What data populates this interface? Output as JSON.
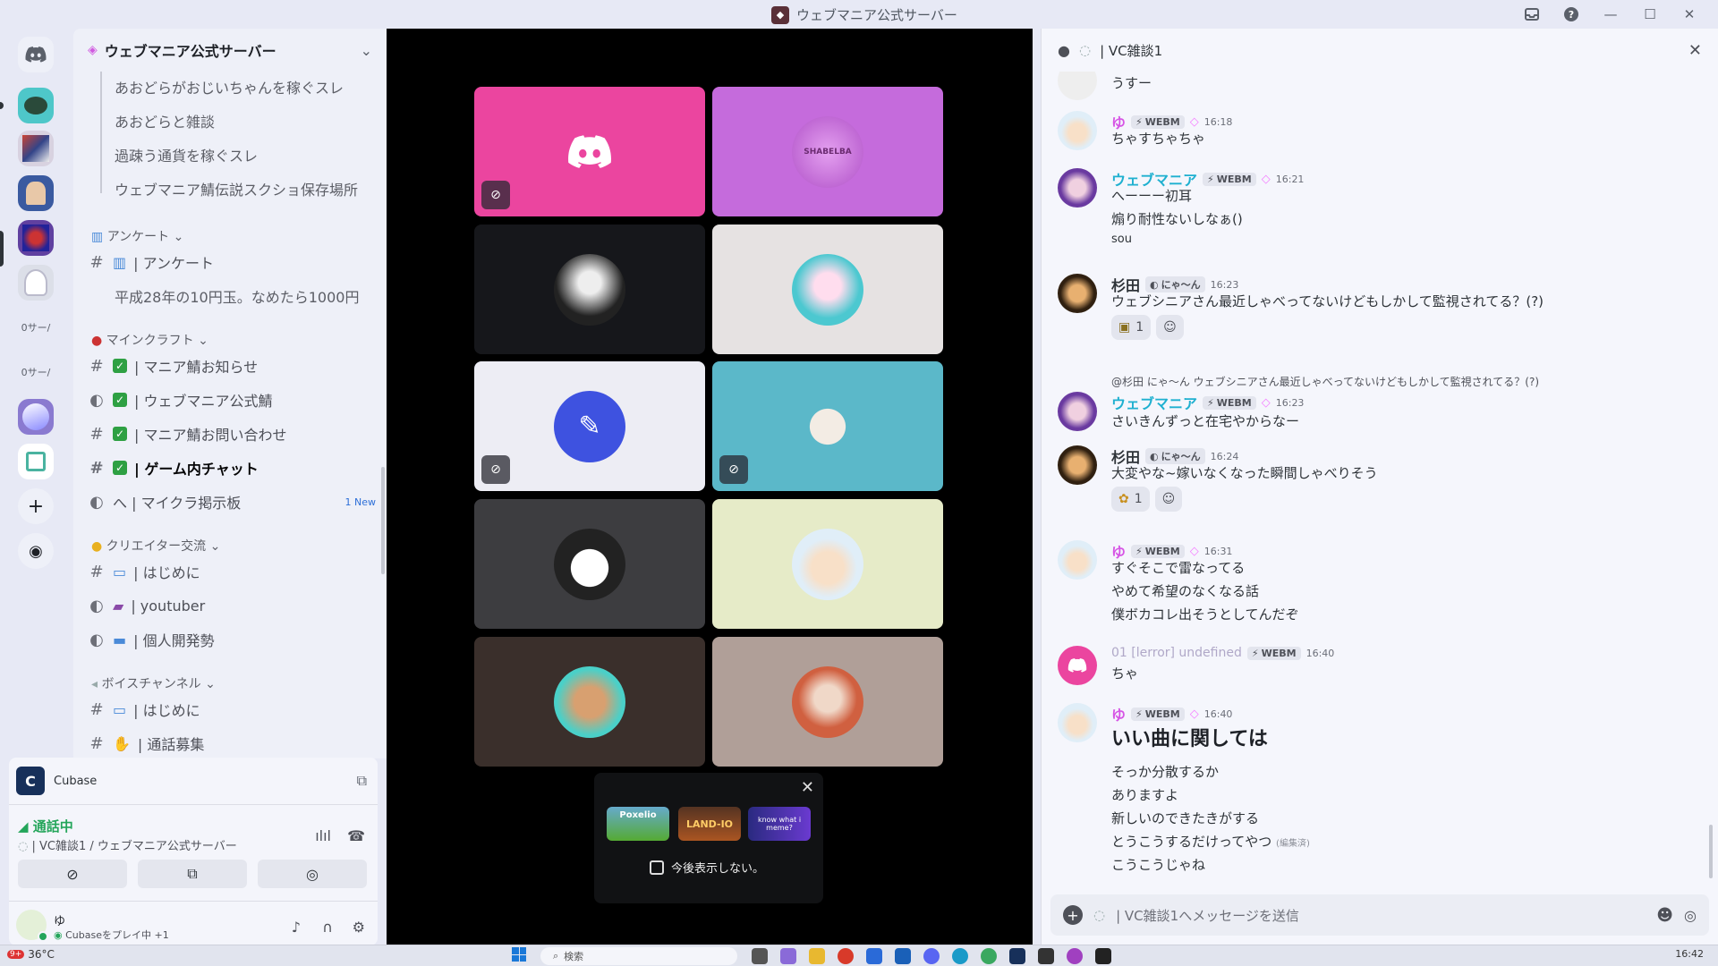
{
  "window": {
    "title": "ウェブマニア公式サーバー"
  },
  "server": {
    "name": "ウェブマニア公式サーバー"
  },
  "server_list": {
    "label1": "ウェブマニア公式サーバー",
    "label2": "ウェブマニア公式サーバー",
    "text1": "0サー/",
    "text2": "0サー/"
  },
  "channels": {
    "threads1": [
      "あおどらがおじいちゃんを稼ぐスレ",
      "あおどらと雑談",
      "過疎う通貨を稼ぐスレ",
      "ウェブマニア鯖伝説スクショ保存場所"
    ],
    "cat_survey": "アンケート",
    "survey_channel": "| アンケート",
    "survey_thread": "平成28年の10円玉。なめたら1000円",
    "cat_minecraft": "マインクラフト",
    "mc_channels": [
      "| マニア鯖お知らせ",
      "| ウェブマニア公式鯖",
      "| マニア鯖お問い合わせ",
      "| ゲーム内チャット",
      "へ | マイクラ掲示板"
    ],
    "mc_badge": "1 New",
    "cat_creator": "クリエイター交流",
    "creator_channels": [
      "| はじめに",
      "| youtuber",
      "| 個人開発勢"
    ],
    "cat_voice": "ボイスチャンネル",
    "voice_channels": [
      "| はじめに",
      "| 通話募集"
    ]
  },
  "panel": {
    "activity_app": "Cubase",
    "voice_status": "通話中",
    "voice_location": "| VC雑談1 / ウェブマニア公式サーバー",
    "user_name": "ゆ",
    "user_status": "Cubaseをプレイ中 +1"
  },
  "stage": {
    "popup_checkbox_label": "今後表示しない。",
    "popup_games": [
      "Poxelio",
      "LAND-IO",
      "know what i meme?"
    ],
    "tile_text": "SHABELBA"
  },
  "chat": {
    "channel_title": "| VC雑談1",
    "input_placeholder": "| VC雑談1へメッセージを送信",
    "messages": [
      {
        "lines": [
          "うすー"
        ]
      },
      {
        "name": "ゆ",
        "tag": "WEBM",
        "time": "16:18",
        "lines": [
          "ちゃすちゃちゃ"
        ]
      },
      {
        "name": "ウェブマニア",
        "tag": "WEBM",
        "time": "16:21",
        "lines": [
          "へーーー初耳",
          "煽り耐性ないしなぁ()",
          "sou"
        ]
      },
      {
        "name": "杉田",
        "tag": "にゃ〜ん",
        "time": "16:23",
        "lines": [
          "ウェブシニアさん最近しゃべってないけどもしかして監視されてる？(?)"
        ],
        "reaction_count": "1"
      },
      {
        "reply": "@杉田  にゃ〜ん ウェブシニアさん最近しゃべってないけどもしかして監視されてる？(?)",
        "name": "ウェブマニア",
        "tag": "WEBM",
        "time": "16:23",
        "lines": [
          "さいきんずっと在宅やからなー"
        ]
      },
      {
        "name": "杉田",
        "tag": "にゃ〜ん",
        "time": "16:24",
        "lines": [
          "大変やな~嫁いなくなった瞬間しゃべりそう"
        ],
        "reaction_count": "1"
      },
      {
        "name": "ゆ",
        "tag": "WEBM",
        "time": "16:31",
        "lines": [
          "すぐそこで雷なってる",
          "やめて希望のなくなる話",
          "僕ボカコレ出そうとしてんだぞ"
        ]
      },
      {
        "name": "01 [lerror] undefined",
        "tag": "WEBM",
        "time": "16:40",
        "lines": [
          "ちゃ"
        ]
      },
      {
        "name": "ゆ",
        "tag": "WEBM",
        "time": "16:40",
        "heading": "いい曲に関しては",
        "lines": [
          "そっか分散するか",
          "ありますよ",
          "新しいのできたきがする",
          "とうこうするだけってやつ",
          "こうこうじゃね"
        ],
        "edited": "(編集済)"
      }
    ]
  },
  "taskbar": {
    "weather": "36°C",
    "search": "検索",
    "clock": "16:42",
    "badge": "9+"
  },
  "colors": {
    "accent": "#5865f2",
    "green": "#23a55a",
    "chat_bg": "#f5f6fc",
    "stage_bg": "#000000",
    "pink_tile": "#eb459f",
    "purple_tile": "#c56bdc",
    "teal_tile": "#5bb8c9"
  }
}
